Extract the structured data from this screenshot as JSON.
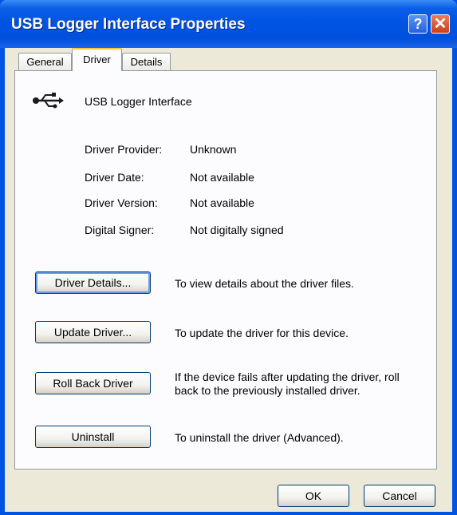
{
  "window": {
    "title": "USB Logger Interface Properties"
  },
  "titlebar": {
    "help_glyph": "?",
    "close_glyph": "✕"
  },
  "tabs": [
    {
      "label": "General"
    },
    {
      "label": "Driver"
    },
    {
      "label": "Details"
    }
  ],
  "device": {
    "icon": "usb-icon",
    "name": "USB Logger Interface"
  },
  "properties": [
    {
      "label": "Driver Provider:",
      "value": "Unknown"
    },
    {
      "label": "Driver Date:",
      "value": "Not available"
    },
    {
      "label": "Driver Version:",
      "value": "Not available"
    },
    {
      "label": "Digital Signer:",
      "value": "Not digitally signed"
    }
  ],
  "actions": [
    {
      "label": "Driver Details...",
      "description": "To view details about the driver files."
    },
    {
      "label": "Update Driver...",
      "description": "To update the driver for this device."
    },
    {
      "label": "Roll Back Driver",
      "description": "If the device fails after updating the driver, roll back to the previously installed driver."
    },
    {
      "label": "Uninstall",
      "description": "To uninstall the driver (Advanced)."
    }
  ],
  "dialog_buttons": {
    "ok": "OK",
    "cancel": "Cancel"
  },
  "colors": {
    "titlebar": "#0054e3",
    "dialog_bg": "#ece9d8",
    "active_tab_accent": "#ffc83c"
  }
}
